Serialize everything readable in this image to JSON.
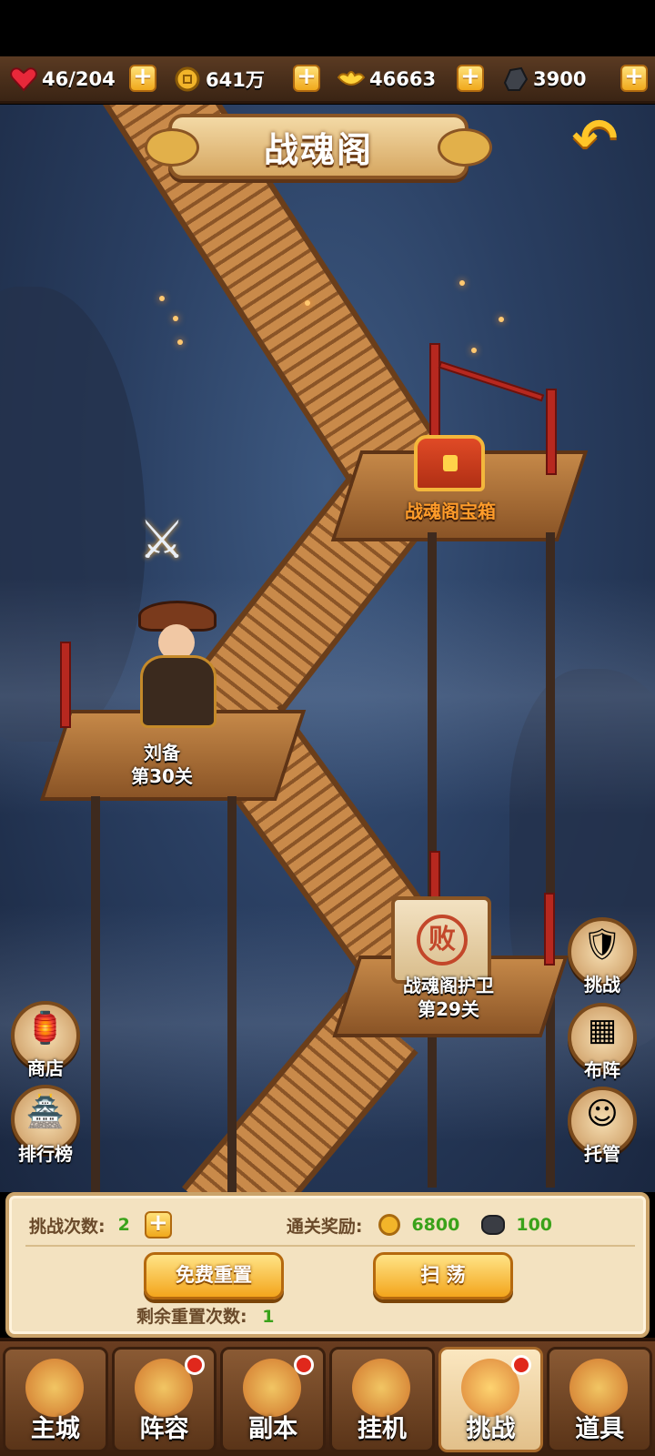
{
  "resources": [
    {
      "icon": "heart-icon",
      "value": "46/204"
    },
    {
      "icon": "coin-icon",
      "value": "641万"
    },
    {
      "icon": "gold-ingot-icon",
      "value": "46663"
    },
    {
      "icon": "ore-icon",
      "value": "3900"
    }
  ],
  "title": "战魂阁",
  "scene": {
    "chest_label": "战魂阁宝箱",
    "player_name": "刘备",
    "player_stage": "第30关",
    "guard_name": "战魂阁护卫",
    "guard_stage": "第29关",
    "defeat_seal": "败"
  },
  "side_left": [
    {
      "label": "商店",
      "icon": "shop-icon"
    },
    {
      "label": "排行榜",
      "icon": "ranking-icon"
    }
  ],
  "side_right": [
    {
      "label": "挑战",
      "icon": "challenge-icon"
    },
    {
      "label": "布阵",
      "icon": "formation-icon"
    },
    {
      "label": "托管",
      "icon": "auto-icon"
    }
  ],
  "panel": {
    "challenge_label": "挑战次数:",
    "challenge_count": "2",
    "reward_label": "通关奖励:",
    "reward_coin": "6800",
    "reward_ore": "100",
    "free_reset": "免费重置",
    "sweep": "扫 荡",
    "remain_label": "剩余重置次数:",
    "remain_count": "1"
  },
  "nav": [
    {
      "label": "主城",
      "badge": false
    },
    {
      "label": "阵容",
      "badge": true
    },
    {
      "label": "副本",
      "badge": true
    },
    {
      "label": "挂机",
      "badge": false
    },
    {
      "label": "挑战",
      "badge": true,
      "active": true
    },
    {
      "label": "道具",
      "badge": false
    }
  ],
  "colors": {
    "accent": "#f3a51c",
    "highlight_text": "#ff9c2a",
    "green_value": "#3aa21a"
  }
}
